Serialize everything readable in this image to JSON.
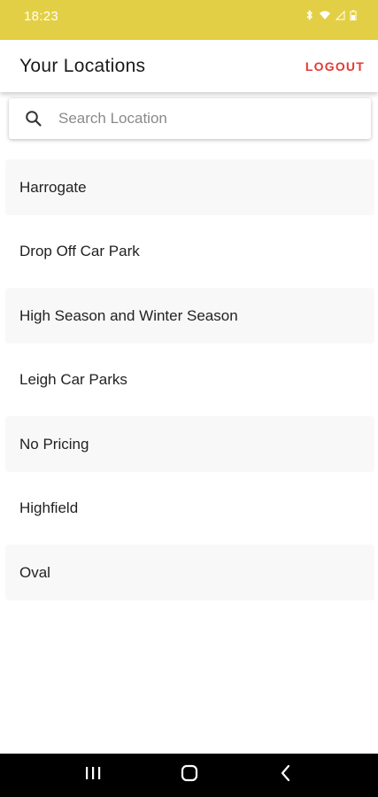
{
  "status_bar": {
    "time": "18:23",
    "icons": [
      "bluetooth-icon",
      "wifi-icon",
      "signal-icon",
      "battery-icon"
    ],
    "background": "#e3cf45"
  },
  "header": {
    "title": "Your Locations",
    "logout_label": "LOGOUT",
    "logout_color": "#e53935"
  },
  "search": {
    "placeholder": "Search Location",
    "value": ""
  },
  "locations": [
    {
      "name": "Harrogate"
    },
    {
      "name": "Drop Off Car Park"
    },
    {
      "name": "High Season and Winter Season"
    },
    {
      "name": "Leigh Car Parks"
    },
    {
      "name": "No Pricing"
    },
    {
      "name": "Highfield"
    },
    {
      "name": "Oval"
    }
  ],
  "nav_bar": {
    "buttons": [
      "recents-icon",
      "home-icon",
      "back-icon"
    ]
  }
}
